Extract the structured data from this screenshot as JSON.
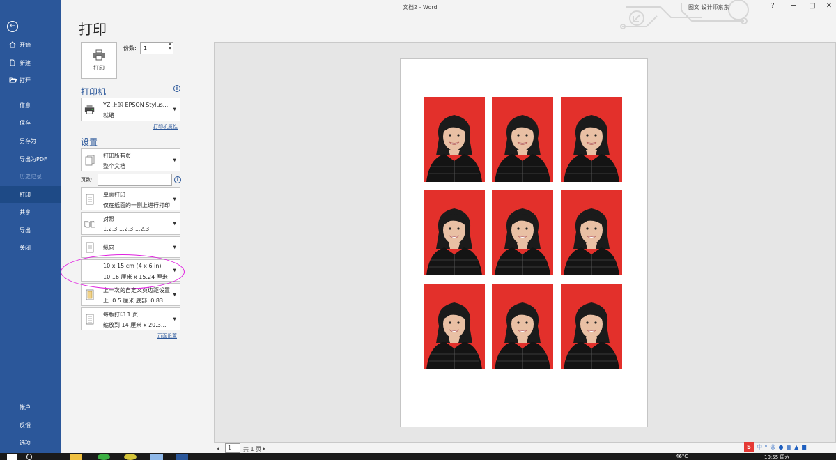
{
  "window": {
    "title": "文档2  -  Word",
    "user": "图文 设计师东东",
    "help": "?",
    "minimize": "─",
    "maximize": "□",
    "close": "✕"
  },
  "sidebar": {
    "back_icon": "←",
    "items": [
      {
        "label": "开始",
        "icon": "home-icon"
      },
      {
        "label": "新建",
        "icon": "new-document-icon"
      },
      {
        "label": "打开",
        "icon": "open-folder-icon"
      },
      {
        "label": "信息"
      },
      {
        "label": "保存"
      },
      {
        "label": "另存为"
      },
      {
        "label": "导出为PDF"
      },
      {
        "label": "历史记录"
      },
      {
        "label": "打印"
      },
      {
        "label": "共享"
      },
      {
        "label": "导出"
      },
      {
        "label": "关闭"
      },
      {
        "label": "帐户"
      },
      {
        "label": "反馈"
      },
      {
        "label": "选项"
      }
    ]
  },
  "print": {
    "heading": "打印",
    "button_label": "打印",
    "copies_label": "份数:",
    "copies_value": "1"
  },
  "printer": {
    "section_title": "打印机",
    "name": "YZ 上的 EPSON Stylus...",
    "status": "就绪",
    "properties_link": "打印机属性"
  },
  "settings": {
    "section_title": "设置",
    "pages_label": "页数:",
    "pages_value": "",
    "page_setup_link": "页面设置",
    "dropdowns": [
      {
        "line1": "打印所有页",
        "line2": "整个文档"
      },
      {
        "line1": "单面打印",
        "line2": "仅在纸面的一侧上进行打印"
      },
      {
        "line1": "对照",
        "line2": "1,2,3    1,2,3    1,2,3"
      },
      {
        "line1": "纵向"
      },
      {
        "line1": "10 x 15 cm (4 x 6 in)",
        "line2": "10.16 厘米 x 15.24 厘米"
      },
      {
        "line1": "上一次的自定义页边距设置",
        "line2": "上: 0.5 厘米 底部: 0.83..."
      },
      {
        "line1": "每版打印 1 页",
        "line2": "缩放到 14 厘米 x 20.3..."
      }
    ]
  },
  "preview": {
    "photo_count": 9,
    "page_current": "1",
    "page_total": "共 1 页"
  },
  "taskbar": {
    "temp": "46°C",
    "time": "10:55 周六"
  },
  "colors": {
    "sidebar": "#2b579a",
    "accent": "#2b579a",
    "photo_bg": "#e3302b",
    "highlight": "#e020e0"
  }
}
